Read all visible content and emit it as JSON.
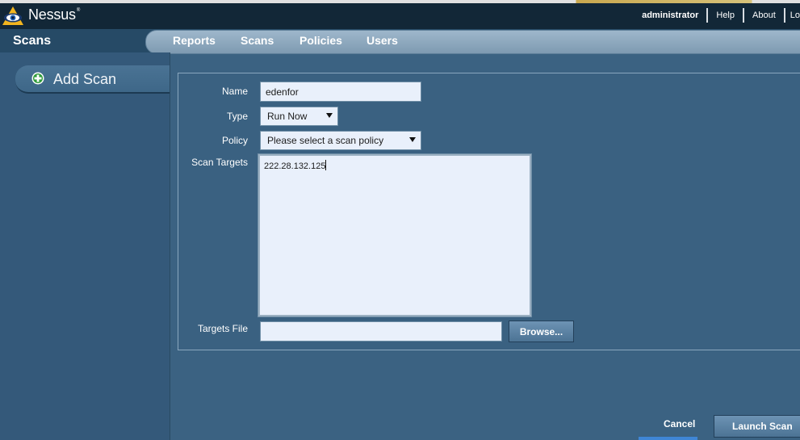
{
  "header": {
    "app_name": "Nessus",
    "trademark": "®",
    "user": "administrator",
    "links": [
      "Help",
      "About",
      "Lo"
    ],
    "logo_icon": "eye-logo-icon"
  },
  "nav": {
    "section_title": "Scans",
    "items": [
      "Reports",
      "Scans",
      "Policies",
      "Users"
    ]
  },
  "sidebar": {
    "add_scan_label": "Add Scan",
    "icon": "plus-circle-icon"
  },
  "form": {
    "name_label": "Name",
    "name_value": "edenfor",
    "type_label": "Type",
    "type_value": "Run Now",
    "policy_label": "Policy",
    "policy_value": "Please select a scan policy",
    "targets_label": "Scan Targets",
    "targets_value": "222.28.132.125",
    "targets_file_label": "Targets File",
    "targets_file_value": "",
    "browse_label": "Browse..."
  },
  "footer": {
    "cancel_label": "Cancel",
    "launch_label": "Launch Scan"
  },
  "colors": {
    "topbar": "#122737",
    "background": "#3b6282",
    "accent": "#3f86d6"
  }
}
